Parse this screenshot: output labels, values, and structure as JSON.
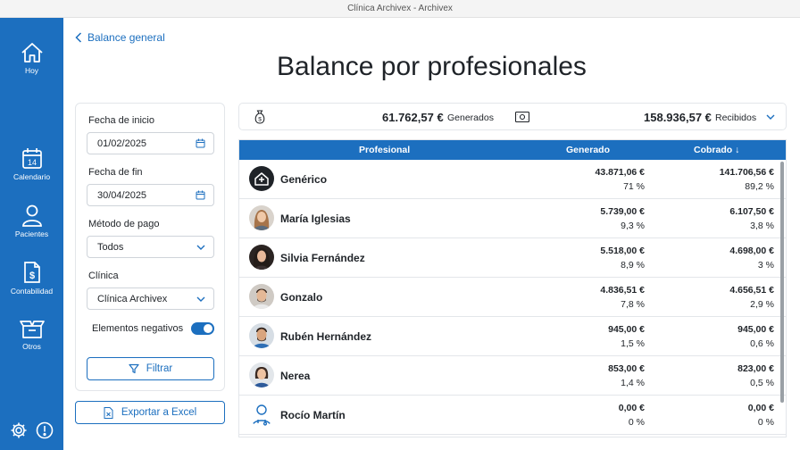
{
  "window": {
    "title": "Clínica Archivex - Archivex"
  },
  "sidebar": {
    "items": [
      {
        "label": "Hoy",
        "icon": "home-icon"
      },
      {
        "label": "Calendario",
        "icon": "calendar-icon",
        "day": "14"
      },
      {
        "label": "Pacientes",
        "icon": "person-icon"
      },
      {
        "label": "Contabilidad",
        "icon": "invoice-icon"
      },
      {
        "label": "Otros",
        "icon": "box-icon"
      }
    ],
    "bottom": [
      {
        "icon": "gear-icon"
      },
      {
        "icon": "alert-icon"
      }
    ]
  },
  "header": {
    "back_label": "Balance general",
    "title": "Balance por profesionales"
  },
  "filters": {
    "start_label": "Fecha de inicio",
    "start_value": "01/02/2025",
    "end_label": "Fecha de fin",
    "end_value": "30/04/2025",
    "payment_label": "Método de pago",
    "payment_value": "Todos",
    "clinic_label": "Clínica",
    "clinic_value": "Clínica Archivex",
    "negatives_label": "Elementos negativos",
    "negatives_on": true,
    "filter_button": "Filtrar"
  },
  "export_button": "Exportar a Excel",
  "summary": {
    "generated_amount": "61.762,57 €",
    "generated_label": "Generados",
    "received_amount": "158.936,57 €",
    "received_label": "Recibidos"
  },
  "table": {
    "headers": {
      "professional": "Profesional",
      "generated": "Generado",
      "collected": "Cobrado ↓"
    },
    "rows": [
      {
        "name": "Genérico",
        "gen": "43.871,06 €",
        "gen_pct": "71 %",
        "cob": "141.706,56 €",
        "cob_pct": "89,2 %",
        "avatar": "clinic-logo"
      },
      {
        "name": "María Iglesias",
        "gen": "5.739,00 €",
        "gen_pct": "9,3 %",
        "cob": "6.107,50 €",
        "cob_pct": "3,8 %",
        "avatar": "photo"
      },
      {
        "name": "Silvia Fernández",
        "gen": "5.518,00 €",
        "gen_pct": "8,9 %",
        "cob": "4.698,00 €",
        "cob_pct": "3 %",
        "avatar": "photo"
      },
      {
        "name": "Gonzalo",
        "gen": "4.836,51 €",
        "gen_pct": "7,8 %",
        "cob": "4.656,51 €",
        "cob_pct": "2,9 %",
        "avatar": "photo"
      },
      {
        "name": "Rubén Hernández",
        "gen": "945,00 €",
        "gen_pct": "1,5 %",
        "cob": "945,00 €",
        "cob_pct": "0,6 %",
        "avatar": "photo"
      },
      {
        "name": "Nerea",
        "gen": "853,00 €",
        "gen_pct": "1,4 %",
        "cob": "823,00 €",
        "cob_pct": "0,5 %",
        "avatar": "photo"
      },
      {
        "name": "Rocío Martín",
        "gen": "0,00 €",
        "gen_pct": "0 %",
        "cob": "0,00 €",
        "cob_pct": "0 %",
        "avatar": "doctor-icon"
      }
    ]
  },
  "colors": {
    "accent": "#1c6fbf",
    "border": "#e3e6ea"
  }
}
